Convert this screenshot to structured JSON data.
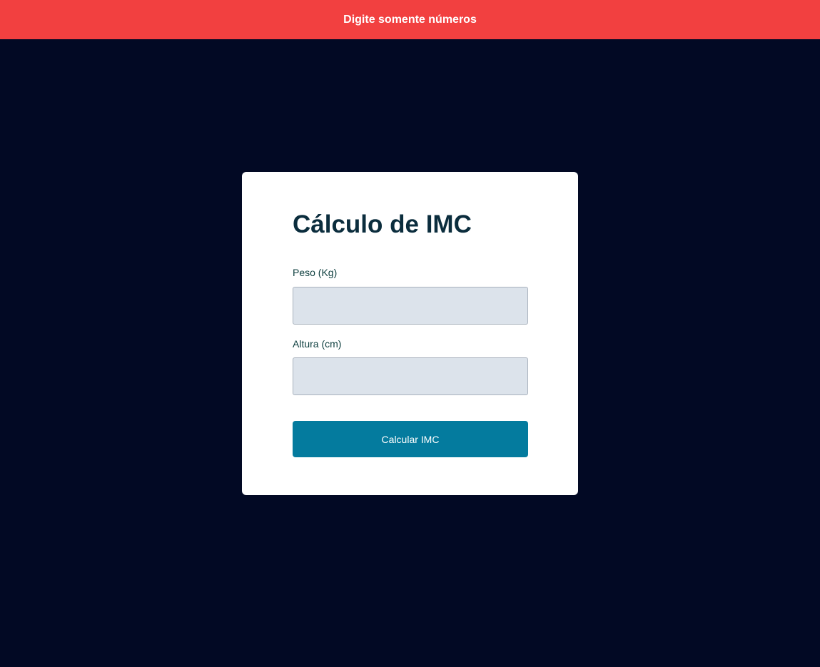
{
  "alert": {
    "message": "Digite somente números",
    "background_color": "#f24040"
  },
  "page": {
    "background_color": "#020924"
  },
  "form": {
    "title": "Cálculo de IMC",
    "peso": {
      "label": "Peso (Kg)",
      "value": "",
      "placeholder": ""
    },
    "altura": {
      "label": "Altura (cm)",
      "value": "",
      "placeholder": ""
    },
    "submit_label": "Calcular IMC",
    "button_color": "#047b9e"
  }
}
